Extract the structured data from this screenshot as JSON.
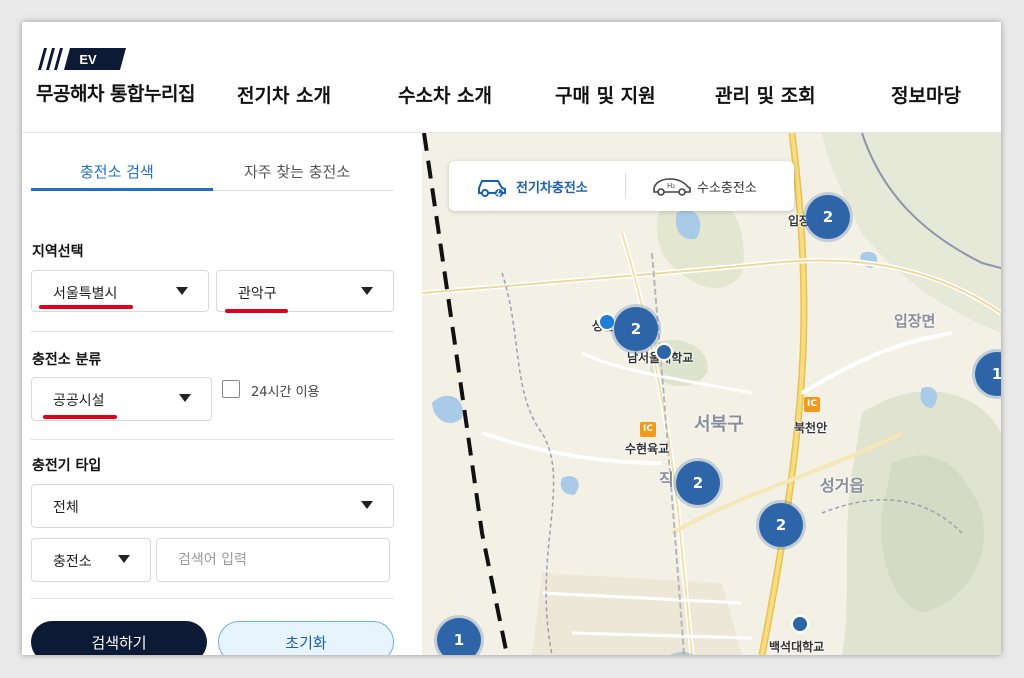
{
  "logo": {
    "badge_text": "EV"
  },
  "site_title": "무공해차 통합누리집",
  "nav": [
    {
      "label": "전기차 소개"
    },
    {
      "label": "수소차 소개"
    },
    {
      "label": "구매 및 지원"
    },
    {
      "label": "관리 및 조회"
    },
    {
      "label": "정보마당"
    }
  ],
  "tabs": [
    {
      "label": "충전소 검색",
      "active": true
    },
    {
      "label": "자주 찾는 충전소",
      "active": false
    }
  ],
  "region": {
    "label": "지역선택",
    "city": "서울특별시",
    "district": "관악구"
  },
  "category": {
    "label": "충전소 분류",
    "value": "공공시설",
    "checkbox_label": "24시간 이용",
    "checked": false
  },
  "charger_type": {
    "label": "충전기 타입",
    "value": "전체"
  },
  "search": {
    "scope": "충전소",
    "placeholder": "검색어 입력"
  },
  "buttons": {
    "search": "검색하기",
    "reset": "초기화"
  },
  "map": {
    "toggle": {
      "ev": "전기차충전소",
      "h2": "수소충전소"
    },
    "clusters": [
      "2",
      "2",
      "2",
      "2",
      "1",
      "1",
      "10"
    ],
    "labels": {
      "ipjang_rest": "입장휴게소",
      "ipjang": "입장면",
      "seonghwan": "성환역",
      "namseoul": "남서울대학교",
      "seobuk": "서북구",
      "bukcheonan": "북천안",
      "suhyeon": "수현육교",
      "jik": "직",
      "seonggeo": "성거읍",
      "baekseok": "백석대학교"
    },
    "ic": "IC",
    "colors": {
      "cluster": "#2e64a8",
      "ev_toggle": "#1a5fb0",
      "accent_red": "#e3001b",
      "dark_button": "#0d1a35"
    }
  }
}
